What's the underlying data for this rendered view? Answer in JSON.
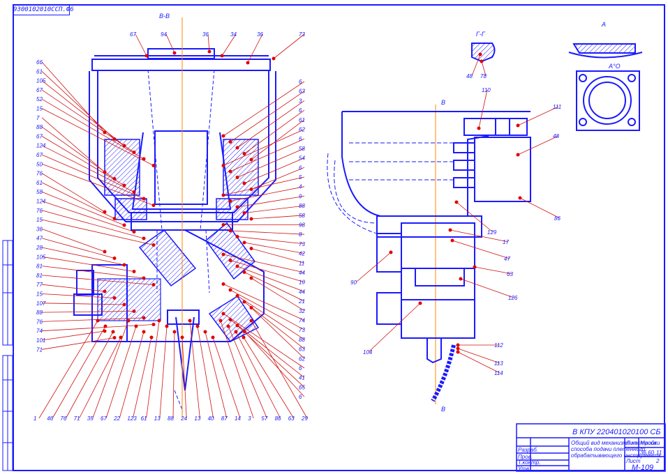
{
  "sheet_code": "9300102010ССП.Ф6",
  "views": {
    "section_vv": "В-В",
    "section_gg": "Г-Г",
    "view_a": "А",
    "view_ar": "А°О",
    "cut_mark": "В"
  },
  "labels_top": [
    "67",
    "94",
    "36",
    "34",
    "36",
    "73"
  ],
  "labels_left": [
    "66",
    "61",
    "105",
    "67",
    "52",
    "15",
    "7",
    "88",
    "67",
    "124",
    "67",
    "50",
    "76",
    "61",
    "58",
    "124",
    "76",
    "15",
    "36",
    "47",
    "28",
    "105",
    "81",
    "81",
    "77",
    "15",
    "107",
    "88",
    "76",
    "74",
    "101",
    "71"
  ],
  "labels_right": [
    "6",
    "63",
    "3",
    "6",
    "61",
    "62",
    "6",
    "58",
    "54",
    "6",
    "5",
    "4",
    "9",
    "88",
    "58",
    "98",
    "8",
    "73",
    "42",
    "11",
    "44",
    "10",
    "44",
    "21",
    "32",
    "74",
    "73",
    "88",
    "63",
    "62",
    "6",
    "41",
    "65",
    "6"
  ],
  "labels_bottom": [
    "1",
    "46",
    "76",
    "71",
    "35",
    "67",
    "22",
    "123",
    "61",
    "13",
    "88",
    "24",
    "13",
    "40",
    "87",
    "14",
    "3",
    "57",
    "86",
    "63",
    "29"
  ],
  "labels_side": [
    "110",
    "111",
    "48",
    "86",
    "129",
    "17",
    "47",
    "63",
    "126",
    "90",
    "104",
    "112",
    "113",
    "114",
    "48",
    "78"
  ],
  "title_block": {
    "doc_number": "В КПУ 220401020100 СБ",
    "name_line1": "Общий вид механизма настройки",
    "name_line2": "способа подачи плетенного",
    "name_line3": "обрабатывающего инструмента",
    "mass": "36.60",
    "scale": "1:1",
    "sheet": "11",
    "sheets": "2",
    "org": "М-109",
    "col_lit": "Лит.",
    "col_mass": "Масса",
    "col_scale": "Масштаб",
    "row_dev": "Разраб.",
    "row_check": "Пров.",
    "row_tcontr": "Т.контр.",
    "row_ncontr": "Н.контр.",
    "row_appr": "Утв.",
    "col_sheet": "Лист",
    "col_sheets": "Листов"
  },
  "colors": {
    "line": "#1a1aff",
    "axis": "#ff8a00",
    "hatch": "#d01010",
    "mark": "#e00000"
  }
}
